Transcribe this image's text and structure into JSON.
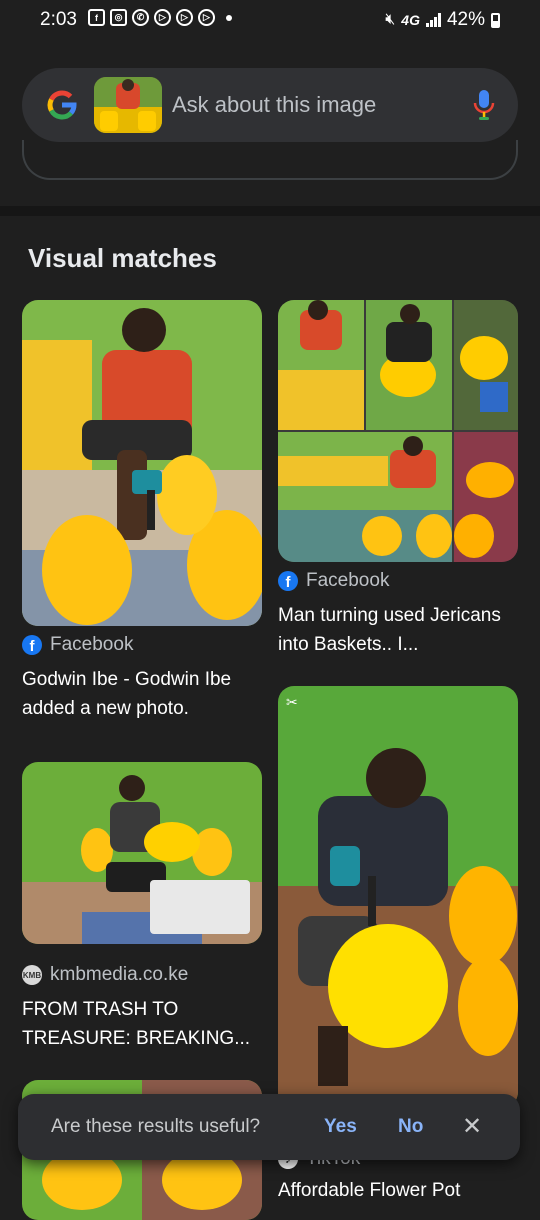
{
  "status": {
    "time": "2:03",
    "network": "4G",
    "battery": "42%"
  },
  "search": {
    "placeholder": "Ask about this image"
  },
  "section": {
    "title": "Visual matches"
  },
  "results": [
    {
      "source": "Facebook",
      "title": "Godwin Ibe - Godwin Ibe added a new photo."
    },
    {
      "source": "Facebook",
      "title": "Man turning used Jericans into Baskets.. I..."
    },
    {
      "source": "kmbmedia.co.ke",
      "title": "FROM TRASH TO TREASURE: BREAKING..."
    },
    {
      "source": "TikTok",
      "title": "Affordable Flower Pot"
    }
  ],
  "feedback": {
    "question": "Are these results useful?",
    "yes": "Yes",
    "no": "No"
  },
  "colors": {
    "background": "#1f1f1f",
    "search_bar": "#303134",
    "accent": "#8ab4f8",
    "facebook": "#1877f2"
  }
}
